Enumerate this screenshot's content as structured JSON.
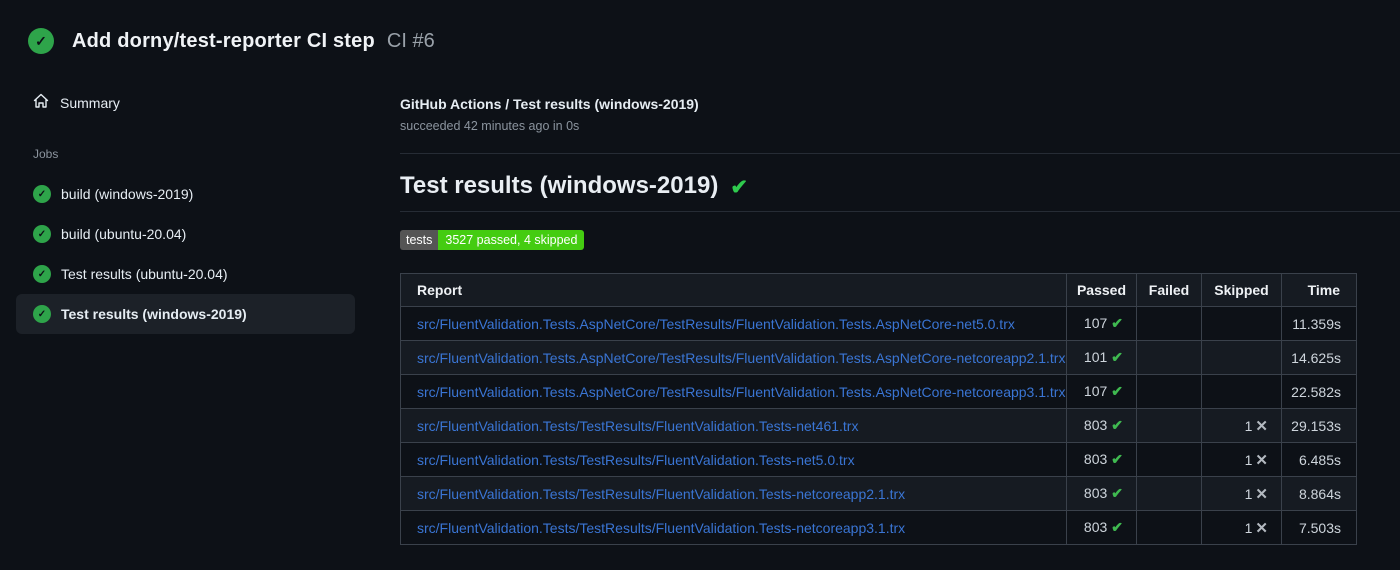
{
  "header": {
    "title": "Add dorny/test-reporter CI step",
    "run_number": "CI #6",
    "status_icon": "check-circle"
  },
  "sidebar": {
    "summary_label": "Summary",
    "jobs_heading": "Jobs",
    "jobs": [
      {
        "label": "build (windows-2019)",
        "selected": false
      },
      {
        "label": "build (ubuntu-20.04)",
        "selected": false
      },
      {
        "label": "Test results (ubuntu-20.04)",
        "selected": false
      },
      {
        "label": "Test results (windows-2019)",
        "selected": true
      }
    ]
  },
  "main": {
    "job_title": "GitHub Actions / Test results (windows-2019)",
    "job_status": "succeeded 42 minutes ago in 0s",
    "section_title": "Test results (windows-2019)",
    "badge": {
      "label": "tests",
      "value": "3527 passed, 4 skipped"
    },
    "table": {
      "columns": [
        "Report",
        "Passed",
        "Failed",
        "Skipped",
        "Time"
      ],
      "rows": [
        {
          "report": "src/FluentValidation.Tests.AspNetCore/TestResults/FluentValidation.Tests.AspNetCore-net5.0.trx",
          "passed": "107",
          "failed": "",
          "skipped": "",
          "time": "11.359s"
        },
        {
          "report": "src/FluentValidation.Tests.AspNetCore/TestResults/FluentValidation.Tests.AspNetCore-netcoreapp2.1.trx",
          "passed": "101",
          "failed": "",
          "skipped": "",
          "time": "14.625s"
        },
        {
          "report": "src/FluentValidation.Tests.AspNetCore/TestResults/FluentValidation.Tests.AspNetCore-netcoreapp3.1.trx",
          "passed": "107",
          "failed": "",
          "skipped": "",
          "time": "22.582s"
        },
        {
          "report": "src/FluentValidation.Tests/TestResults/FluentValidation.Tests-net461.trx",
          "passed": "803",
          "failed": "",
          "skipped": "1",
          "time": "29.153s"
        },
        {
          "report": "src/FluentValidation.Tests/TestResults/FluentValidation.Tests-net5.0.trx",
          "passed": "803",
          "failed": "",
          "skipped": "1",
          "time": "6.485s"
        },
        {
          "report": "src/FluentValidation.Tests/TestResults/FluentValidation.Tests-netcoreapp2.1.trx",
          "passed": "803",
          "failed": "",
          "skipped": "1",
          "time": "8.864s"
        },
        {
          "report": "src/FluentValidation.Tests/TestResults/FluentValidation.Tests-netcoreapp3.1.trx",
          "passed": "803",
          "failed": "",
          "skipped": "1",
          "time": "7.503s"
        }
      ]
    }
  },
  "icons": {
    "status_check_glyph": "✓",
    "passed_check_glyph": "✔",
    "skipped_cross_glyph": "✕",
    "home_icon": "house-outline"
  },
  "colors": {
    "background": "#0d1117",
    "panel_selected": "#1c2128",
    "circle_green": "#2ea44a",
    "check_green": "#3fb950",
    "badge_gray": "#555555",
    "badge_green": "#44cc11",
    "link_blue": "#3a75d4",
    "muted_text": "#8b949e",
    "table_border": "#3a414b"
  }
}
